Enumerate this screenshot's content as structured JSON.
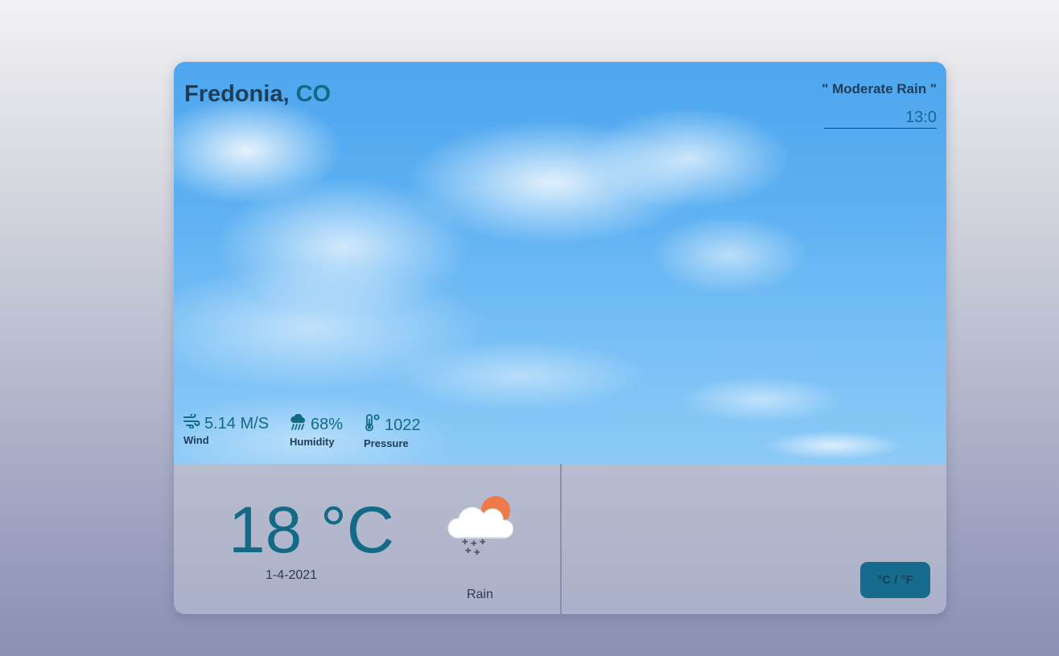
{
  "location": {
    "city": "Fredonia,",
    "state": "CO"
  },
  "condition": {
    "description": "\" Moderate Rain \"",
    "time": "13:0"
  },
  "metrics": [
    {
      "icon": "wind-icon",
      "value": "5.14 M/S",
      "label": "Wind"
    },
    {
      "icon": "rain-cloud-icon",
      "value": "68%",
      "label": "Humidity"
    },
    {
      "icon": "thermometer-icon",
      "value": "1022",
      "label": "Pressure"
    }
  ],
  "current": {
    "temperature": "18 °C",
    "date": "1-4-2021",
    "weather_icon": "cloud-sun-rain-icon",
    "weather_label": "Rain"
  },
  "controls": {
    "unit_toggle_label": "°C / °F"
  },
  "colors": {
    "accent": "#136a86",
    "text_dark": "#1f3d57",
    "button_bg": "#166c8c",
    "sun": "#ee7a4a"
  }
}
